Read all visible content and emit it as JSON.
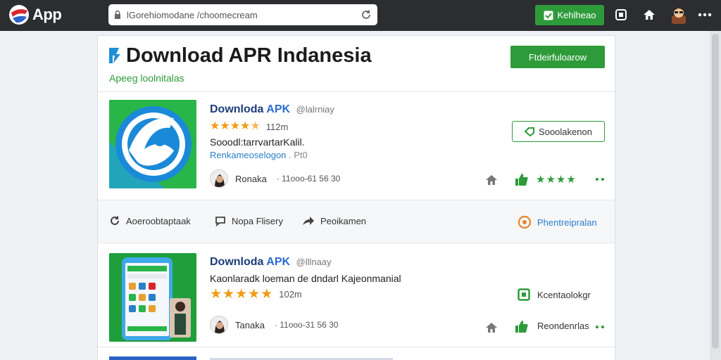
{
  "browser": {
    "brand": "App",
    "address": "lGorehiomodane /choomecream",
    "cta_label": "Kehlheao"
  },
  "header": {
    "title": "Download APR Indanesia",
    "subtitle": "Apeeg loolnitalas",
    "button_label": "Ftdeirfuloarow"
  },
  "listings": [
    {
      "name": "Downloda",
      "name_accent": "APK",
      "handle": "@lalrniay",
      "rating": 4.5,
      "rating_text": "112m",
      "description": "Sooodl:tarrvartarKalil.",
      "link_text": "Renkameoselogon",
      "link_meta": ". Pt0",
      "author": "Ronaka",
      "author_meta": "· 11ooo-61 56 30",
      "action_label": "Sooolakenon"
    },
    {
      "name": "Downloda",
      "name_accent": "APK",
      "handle": "@lllnaay",
      "rating": 5,
      "rating_text": "102m",
      "description": "Kaonlaradk loeman de dndarl Kajeonmanial",
      "author": "Tanaka",
      "author_meta": "· 11ooo-31 56 30",
      "green_link_label": "Kcentaolokgr",
      "green_text": "Reondenrlas"
    }
  ],
  "actionbar": [
    {
      "label": "Aoeroobtaptaak",
      "icon": "refresh-icon"
    },
    {
      "label": "Nopa Flisery",
      "icon": "chat-icon"
    },
    {
      "label": "Peoikamen",
      "icon": "share-icon"
    },
    {
      "label": "Phentreipralan",
      "icon": "badge-icon"
    }
  ],
  "colors": {
    "topbar": "#2b2d30",
    "green": "#2e9b3a",
    "blue": "#2a7fc9",
    "star": "#f29a14",
    "title_blue": "#1c3d7a"
  }
}
